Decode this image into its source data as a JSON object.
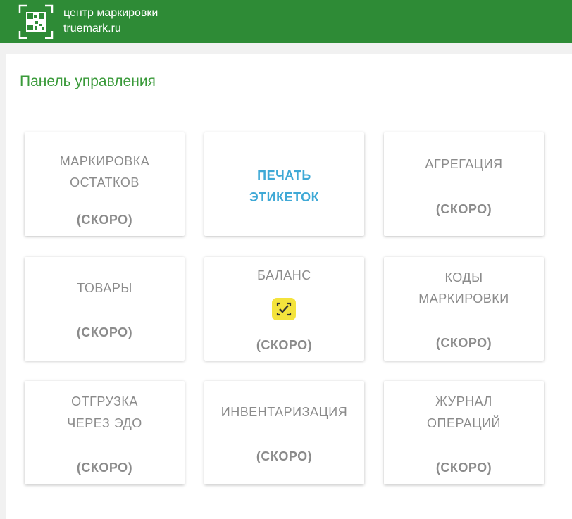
{
  "header": {
    "brand_line1": "центр маркировки",
    "brand_line2": "truemark.ru",
    "logo_icon": "qr-code-icon",
    "color": "#2e8b36"
  },
  "panel": {
    "title": "Панель управления"
  },
  "tiles": [
    {
      "line1": "МАРКИРОВКА",
      "line2": "ОСТАТКОВ",
      "status": "(СКОРО)"
    },
    {
      "line1": "ПЕЧАТЬ",
      "line2": "ЭТИКЕТОК",
      "status": ""
    },
    {
      "line1": "АГРЕГАЦИЯ",
      "line2": "",
      "status": "(СКОРО)"
    },
    {
      "line1": "ТОВАРЫ",
      "line2": "",
      "status": "(СКОРО)"
    },
    {
      "line1": "БАЛАНС",
      "line2": "",
      "status": "(СКОРО)",
      "icon": "scan-check-icon"
    },
    {
      "line1": "КОДЫ",
      "line2": "МАРКИРОВКИ",
      "status": "(СКОРО)"
    },
    {
      "line1": "ОТГРУЗКА",
      "line2": "ЧЕРЕЗ ЭДО",
      "status": "(СКОРО)"
    },
    {
      "line1": "ИНВЕНТАРИЗАЦИЯ",
      "line2": "",
      "status": "(СКОРО)"
    },
    {
      "line1": "ЖУРНАЛ",
      "line2": "ОПЕРАЦИЙ",
      "status": "(СКОРО)"
    }
  ]
}
